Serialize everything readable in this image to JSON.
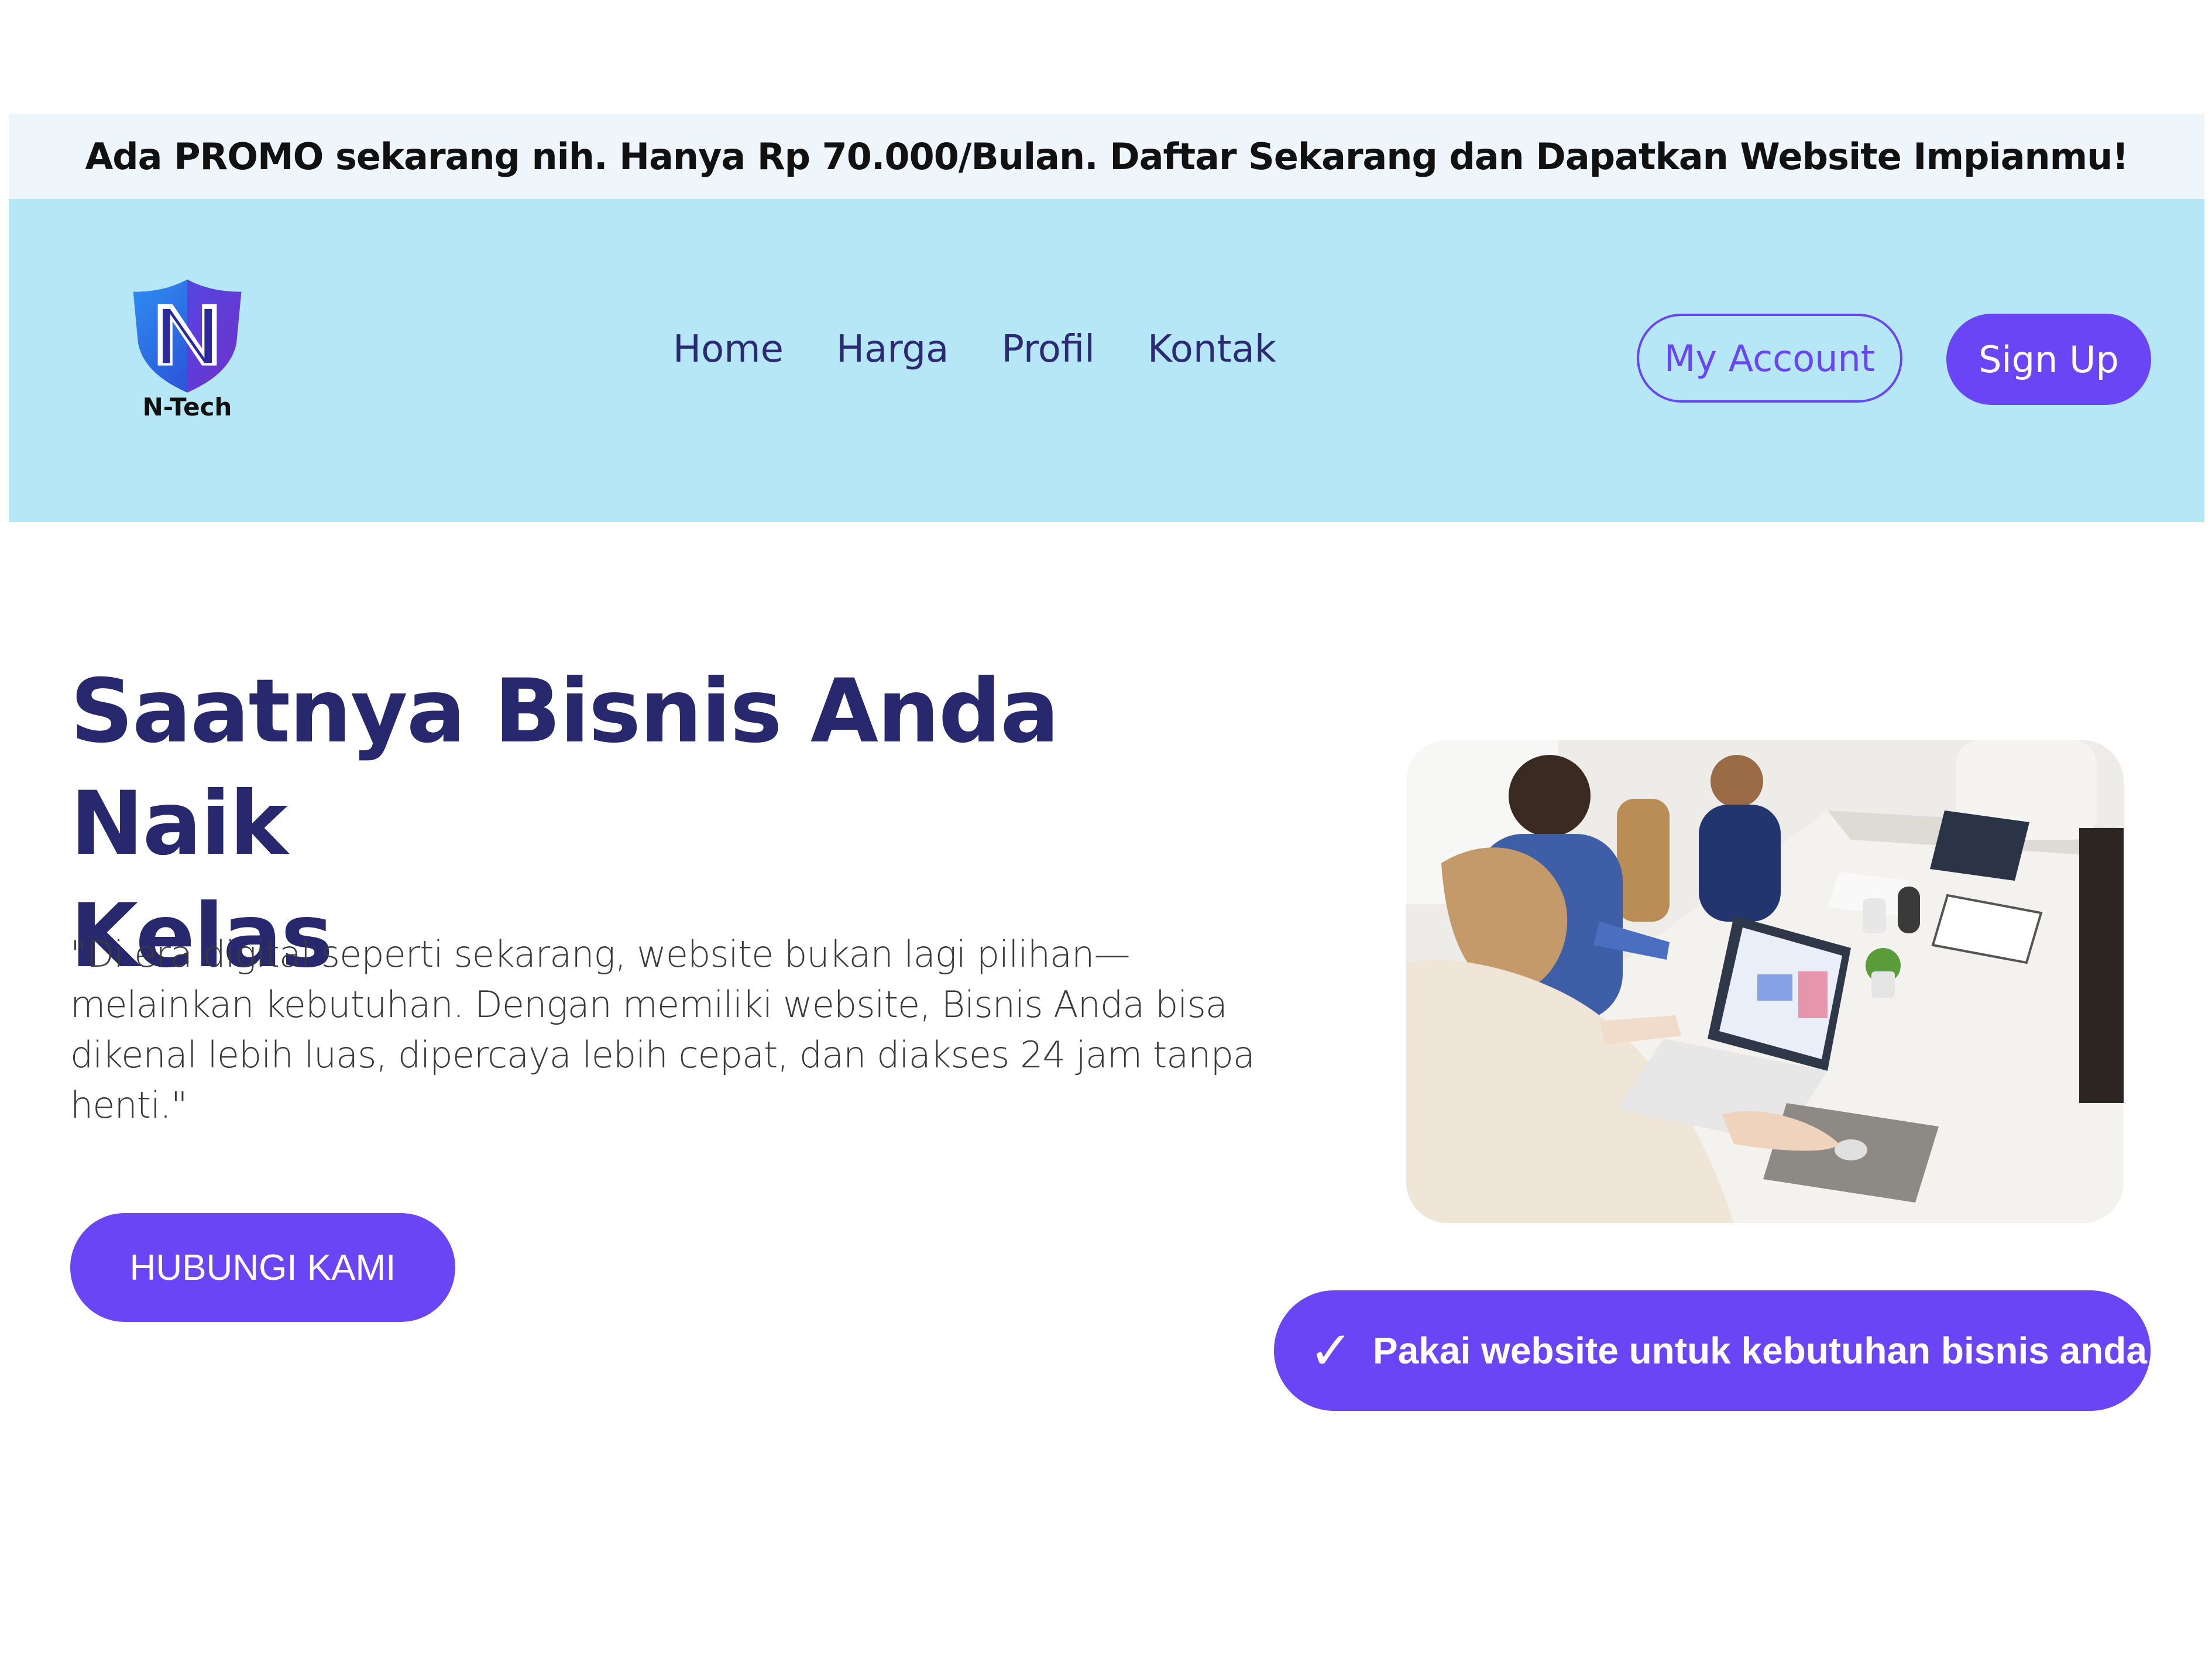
{
  "promo": {
    "text": "Ada PROMO sekarang nih. Hanya Rp 70.000/Bulan. Daftar Sekarang dan Dapatkan Website Impianmu!"
  },
  "header": {
    "logo": {
      "icon": "shield-n-logo-icon",
      "text": "N-Tech"
    },
    "nav": [
      {
        "label": "Home"
      },
      {
        "label": "Harga"
      },
      {
        "label": "Profil"
      },
      {
        "label": "Kontak"
      }
    ],
    "account_label": "My Account",
    "signup_label": "Sign Up"
  },
  "hero": {
    "title_line1": "Saatnya Bisnis Anda Naik",
    "title_line2": "Kelas",
    "description": "\"Di era digital seperti sekarang, website bukan lagi pilihan—melainkan kebutuhan. Dengan memiliki website, Bisnis Anda bisa dikenal lebih luas, dipercaya lebih cepat, dan diakses 24 jam tanpa henti.\"",
    "cta_label": "HUBUNGI KAMI",
    "image": "business-team-meeting-photo",
    "badge": {
      "icon": "check-icon",
      "text": "Pakai website untuk kebutuhan bisnis anda"
    }
  },
  "colors": {
    "accent": "#6a45f5",
    "header_bg": "#b5e7f7",
    "promo_bg": "#eef6fc",
    "title": "#28286e",
    "nav_text": "#2b2a72"
  }
}
